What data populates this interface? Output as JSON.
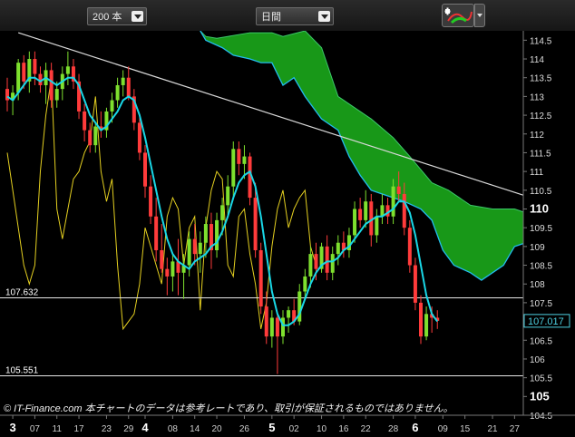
{
  "toolbar": {
    "count_select": "200 本",
    "period_select": "日間",
    "tool_icon": "ichimoku-tool-icon"
  },
  "colors": {
    "cloud": "#19a019",
    "cloud_line": "#22bbee",
    "ma": "#19d7e6",
    "osc": "#e5d020",
    "up_candle": "#7ee02e",
    "down_candle": "#ff3b3b",
    "trendline": "#d8d8d8",
    "hline": "#e8e8e8",
    "last_price_box": "#4dd0e1"
  },
  "chart_data": {
    "type": "candlestick",
    "title": "",
    "ylim": [
      104.5,
      114.75
    ],
    "y_ticks": [
      "114.5",
      "114",
      "113.5",
      "113",
      "112.5",
      "112",
      "111.5",
      "111",
      "110.5",
      "110",
      "109.5",
      "109",
      "108.5",
      "108",
      "107.5",
      "107",
      "106.5",
      "106",
      "105.5",
      "105",
      "104.5"
    ],
    "y_ticks_bold": [
      "110",
      "105"
    ],
    "x_labels": [
      {
        "label": "3",
        "bold": true,
        "i": 1
      },
      {
        "label": "07",
        "bold": false,
        "i": 5
      },
      {
        "label": "11",
        "bold": false,
        "i": 9
      },
      {
        "label": "17",
        "bold": false,
        "i": 13
      },
      {
        "label": "23",
        "bold": false,
        "i": 18
      },
      {
        "label": "29",
        "bold": false,
        "i": 22
      },
      {
        "label": "4",
        "bold": true,
        "i": 25
      },
      {
        "label": "08",
        "bold": false,
        "i": 30
      },
      {
        "label": "14",
        "bold": false,
        "i": 34
      },
      {
        "label": "20",
        "bold": false,
        "i": 38
      },
      {
        "label": "26",
        "bold": false,
        "i": 43
      },
      {
        "label": "5",
        "bold": true,
        "i": 48
      },
      {
        "label": "02",
        "bold": false,
        "i": 52
      },
      {
        "label": "10",
        "bold": false,
        "i": 57
      },
      {
        "label": "16",
        "bold": false,
        "i": 61
      },
      {
        "label": "22",
        "bold": false,
        "i": 65
      },
      {
        "label": "28",
        "bold": false,
        "i": 70
      },
      {
        "label": "6",
        "bold": true,
        "i": 74
      },
      {
        "label": "09",
        "bold": false,
        "i": 79
      },
      {
        "label": "15",
        "bold": false,
        "i": 83
      },
      {
        "label": "21",
        "bold": false,
        "i": 88
      },
      {
        "label": "27",
        "bold": false,
        "i": 92
      }
    ],
    "hlines": [
      {
        "value": 107.632,
        "label": "107.632"
      },
      {
        "value": 105.551,
        "label": "105.551"
      }
    ],
    "last_price": {
      "value": 107.017,
      "label": "107.017"
    },
    "trendline": {
      "from": {
        "i": 2,
        "y": 114.7
      },
      "to": {
        "i": 94,
        "y": 110.35
      }
    },
    "candles": [
      [
        113.2,
        113.5,
        112.6,
        112.9
      ],
      [
        112.9,
        113.3,
        112.5,
        113.1
      ],
      [
        113.1,
        114.0,
        112.9,
        113.9
      ],
      [
        113.9,
        114.1,
        113.2,
        113.4
      ],
      [
        113.4,
        114.2,
        113.1,
        114.0
      ],
      [
        114.0,
        114.2,
        113.3,
        113.6
      ],
      [
        113.6,
        113.8,
        113.1,
        113.3
      ],
      [
        113.3,
        113.9,
        112.8,
        113.7
      ],
      [
        113.7,
        113.9,
        112.7,
        112.9
      ],
      [
        112.9,
        113.4,
        112.7,
        113.2
      ],
      [
        113.2,
        113.8,
        112.9,
        113.6
      ],
      [
        113.6,
        114.2,
        113.3,
        113.8
      ],
      [
        113.8,
        114.0,
        113.2,
        113.4
      ],
      [
        113.4,
        113.6,
        112.4,
        112.6
      ],
      [
        112.6,
        112.8,
        111.8,
        112.1
      ],
      [
        112.1,
        112.3,
        111.5,
        111.7
      ],
      [
        111.7,
        112.3,
        111.5,
        112.2
      ],
      [
        112.2,
        112.6,
        111.9,
        112.1
      ],
      [
        112.1,
        112.7,
        111.9,
        112.6
      ],
      [
        112.6,
        113.1,
        112.3,
        112.9
      ],
      [
        112.9,
        113.5,
        112.7,
        113.3
      ],
      [
        113.3,
        113.7,
        113.0,
        113.5
      ],
      [
        113.5,
        113.8,
        112.9,
        113.0
      ],
      [
        113.0,
        113.2,
        112.1,
        112.3
      ],
      [
        112.3,
        112.5,
        111.3,
        111.5
      ],
      [
        111.5,
        111.7,
        110.3,
        110.6
      ],
      [
        110.6,
        110.9,
        109.6,
        109.8
      ],
      [
        109.8,
        110.3,
        108.6,
        108.9
      ],
      [
        108.9,
        109.6,
        108.3,
        108.4
      ],
      [
        108.4,
        108.7,
        107.7,
        108.2
      ],
      [
        108.2,
        108.8,
        107.8,
        108.6
      ],
      [
        108.6,
        109.2,
        107.7,
        108.3
      ],
      [
        108.3,
        108.8,
        107.6,
        108.5
      ],
      [
        108.5,
        109.4,
        108.2,
        109.2
      ],
      [
        109.2,
        109.6,
        108.5,
        108.8
      ],
      [
        108.8,
        109.4,
        108.3,
        109.1
      ],
      [
        109.1,
        109.8,
        108.7,
        109.6
      ],
      [
        109.6,
        109.9,
        108.4,
        108.9
      ],
      [
        108.9,
        109.9,
        108.7,
        109.7
      ],
      [
        109.7,
        110.3,
        109.3,
        110.1
      ],
      [
        110.1,
        110.9,
        109.8,
        110.6
      ],
      [
        110.6,
        111.8,
        110.3,
        111.6
      ],
      [
        111.6,
        111.8,
        110.9,
        111.2
      ],
      [
        111.2,
        111.7,
        110.8,
        111.4
      ],
      [
        111.4,
        111.5,
        110.1,
        110.3
      ],
      [
        110.3,
        110.7,
        108.7,
        108.9
      ],
      [
        108.9,
        109.1,
        107.2,
        107.4
      ],
      [
        107.4,
        107.8,
        106.4,
        106.6
      ],
      [
        106.6,
        107.3,
        106.3,
        107.1
      ],
      [
        107.1,
        107.2,
        105.6,
        106.6
      ],
      [
        106.6,
        107.3,
        106.4,
        107.1
      ],
      [
        107.1,
        107.4,
        106.7,
        107.3
      ],
      [
        107.3,
        107.6,
        106.9,
        107.0
      ],
      [
        107.0,
        108.0,
        106.9,
        107.8
      ],
      [
        107.8,
        108.4,
        107.6,
        108.2
      ],
      [
        108.2,
        109.0,
        107.9,
        108.8
      ],
      [
        108.8,
        109.1,
        108.1,
        108.4
      ],
      [
        108.4,
        109.1,
        108.3,
        109.0
      ],
      [
        109.0,
        109.3,
        108.1,
        108.3
      ],
      [
        108.3,
        109.0,
        108.1,
        108.8
      ],
      [
        108.8,
        109.3,
        108.5,
        109.1
      ],
      [
        109.1,
        109.4,
        108.7,
        108.9
      ],
      [
        108.9,
        109.5,
        108.7,
        109.3
      ],
      [
        109.3,
        110.2,
        109.1,
        110.0
      ],
      [
        110.0,
        110.3,
        109.5,
        109.7
      ],
      [
        109.7,
        110.5,
        109.5,
        110.2
      ],
      [
        110.2,
        110.4,
        109.0,
        109.3
      ],
      [
        109.3,
        110.0,
        109.1,
        109.8
      ],
      [
        109.8,
        110.4,
        109.6,
        110.1
      ],
      [
        110.1,
        110.3,
        109.6,
        109.8
      ],
      [
        109.8,
        110.8,
        109.6,
        110.6
      ],
      [
        110.6,
        111.0,
        110.2,
        110.4
      ],
      [
        110.4,
        110.7,
        109.3,
        109.5
      ],
      [
        109.5,
        109.7,
        108.3,
        108.5
      ],
      [
        108.5,
        108.7,
        107.3,
        107.5
      ],
      [
        107.5,
        107.7,
        106.4,
        106.6
      ],
      [
        106.6,
        107.4,
        106.5,
        107.2
      ],
      [
        107.2,
        107.4,
        106.7,
        107.1
      ],
      [
        107.1,
        107.3,
        106.8,
        107.017
      ]
    ],
    "ma": [
      113.0,
      112.9,
      113.1,
      113.3,
      113.5,
      113.5,
      113.4,
      113.5,
      113.4,
      113.3,
      113.4,
      113.5,
      113.5,
      113.3,
      112.9,
      112.5,
      112.3,
      112.1,
      112.2,
      112.4,
      112.6,
      112.9,
      113.0,
      112.9,
      112.5,
      111.9,
      111.2,
      110.5,
      109.8,
      109.2,
      108.8,
      108.6,
      108.5,
      108.4,
      108.6,
      108.7,
      108.8,
      109.0,
      109.1,
      109.4,
      109.8,
      110.3,
      110.7,
      110.9,
      111.0,
      110.6,
      109.8,
      108.8,
      107.8,
      107.2,
      106.9,
      106.9,
      107.0,
      107.2,
      107.6,
      108.0,
      108.3,
      108.5,
      108.6,
      108.6,
      108.7,
      108.9,
      109.0,
      109.2,
      109.4,
      109.6,
      109.7,
      109.8,
      109.8,
      109.9,
      110.0,
      110.2,
      110.2,
      109.9,
      109.3,
      108.5,
      107.7,
      107.2,
      107.0
    ],
    "cloud_upper": [
      [
        35,
        114.75
      ],
      [
        36,
        114.6
      ],
      [
        38,
        114.55
      ],
      [
        40,
        114.6
      ],
      [
        44,
        114.7
      ],
      [
        48,
        114.7
      ],
      [
        50,
        114.6
      ],
      [
        54,
        114.75
      ],
      [
        57,
        114.3
      ],
      [
        60,
        113.0
      ],
      [
        62,
        112.8
      ],
      [
        66,
        112.4
      ],
      [
        70,
        111.9
      ],
      [
        73,
        111.4
      ],
      [
        77,
        110.7
      ],
      [
        80,
        110.5
      ],
      [
        84,
        110.1
      ],
      [
        88,
        110.0
      ],
      [
        92,
        110.0
      ],
      [
        94,
        109.9
      ]
    ],
    "cloud_lower": [
      [
        35,
        114.75
      ],
      [
        36,
        114.5
      ],
      [
        39,
        114.3
      ],
      [
        41,
        114.1
      ],
      [
        44,
        114.0
      ],
      [
        46,
        113.9
      ],
      [
        48,
        113.9
      ],
      [
        50,
        113.3
      ],
      [
        52,
        113.5
      ],
      [
        54,
        113.0
      ],
      [
        57,
        112.4
      ],
      [
        60,
        112.1
      ],
      [
        62,
        111.4
      ],
      [
        64,
        110.9
      ],
      [
        66,
        110.5
      ],
      [
        70,
        110.3
      ],
      [
        72,
        110.2
      ],
      [
        75,
        110.0
      ],
      [
        77,
        109.7
      ],
      [
        79,
        108.9
      ],
      [
        81,
        108.5
      ],
      [
        84,
        108.3
      ],
      [
        86,
        108.1
      ],
      [
        88,
        108.3
      ],
      [
        90,
        108.5
      ],
      [
        92,
        109.0
      ],
      [
        94,
        109.1
      ]
    ],
    "oscillator": [
      111.5,
      110.5,
      109.5,
      108.5,
      108.0,
      108.5,
      111.0,
      112.5,
      113.5,
      110.0,
      109.2,
      110.0,
      110.8,
      111.0,
      111.5,
      111.8,
      113.0,
      111.0,
      110.2,
      110.8,
      108.5,
      106.8,
      107.0,
      107.2,
      108.0,
      109.5,
      109.0,
      108.5,
      108.0,
      109.8,
      110.3,
      110.0,
      108.5,
      109.5,
      109.8,
      107.3,
      109.5,
      110.5,
      111.0,
      110.8,
      108.5,
      108.2,
      109.8,
      110.0,
      108.8,
      108.0,
      106.8,
      107.5,
      109.0,
      110.0,
      110.5,
      109.5,
      110.0,
      110.3,
      110.5,
      109.0,
      108.5
    ]
  },
  "copyright": "© IT-Finance.com  本チャートのデータは参考レートであり、取引が保証されるものではありません。"
}
